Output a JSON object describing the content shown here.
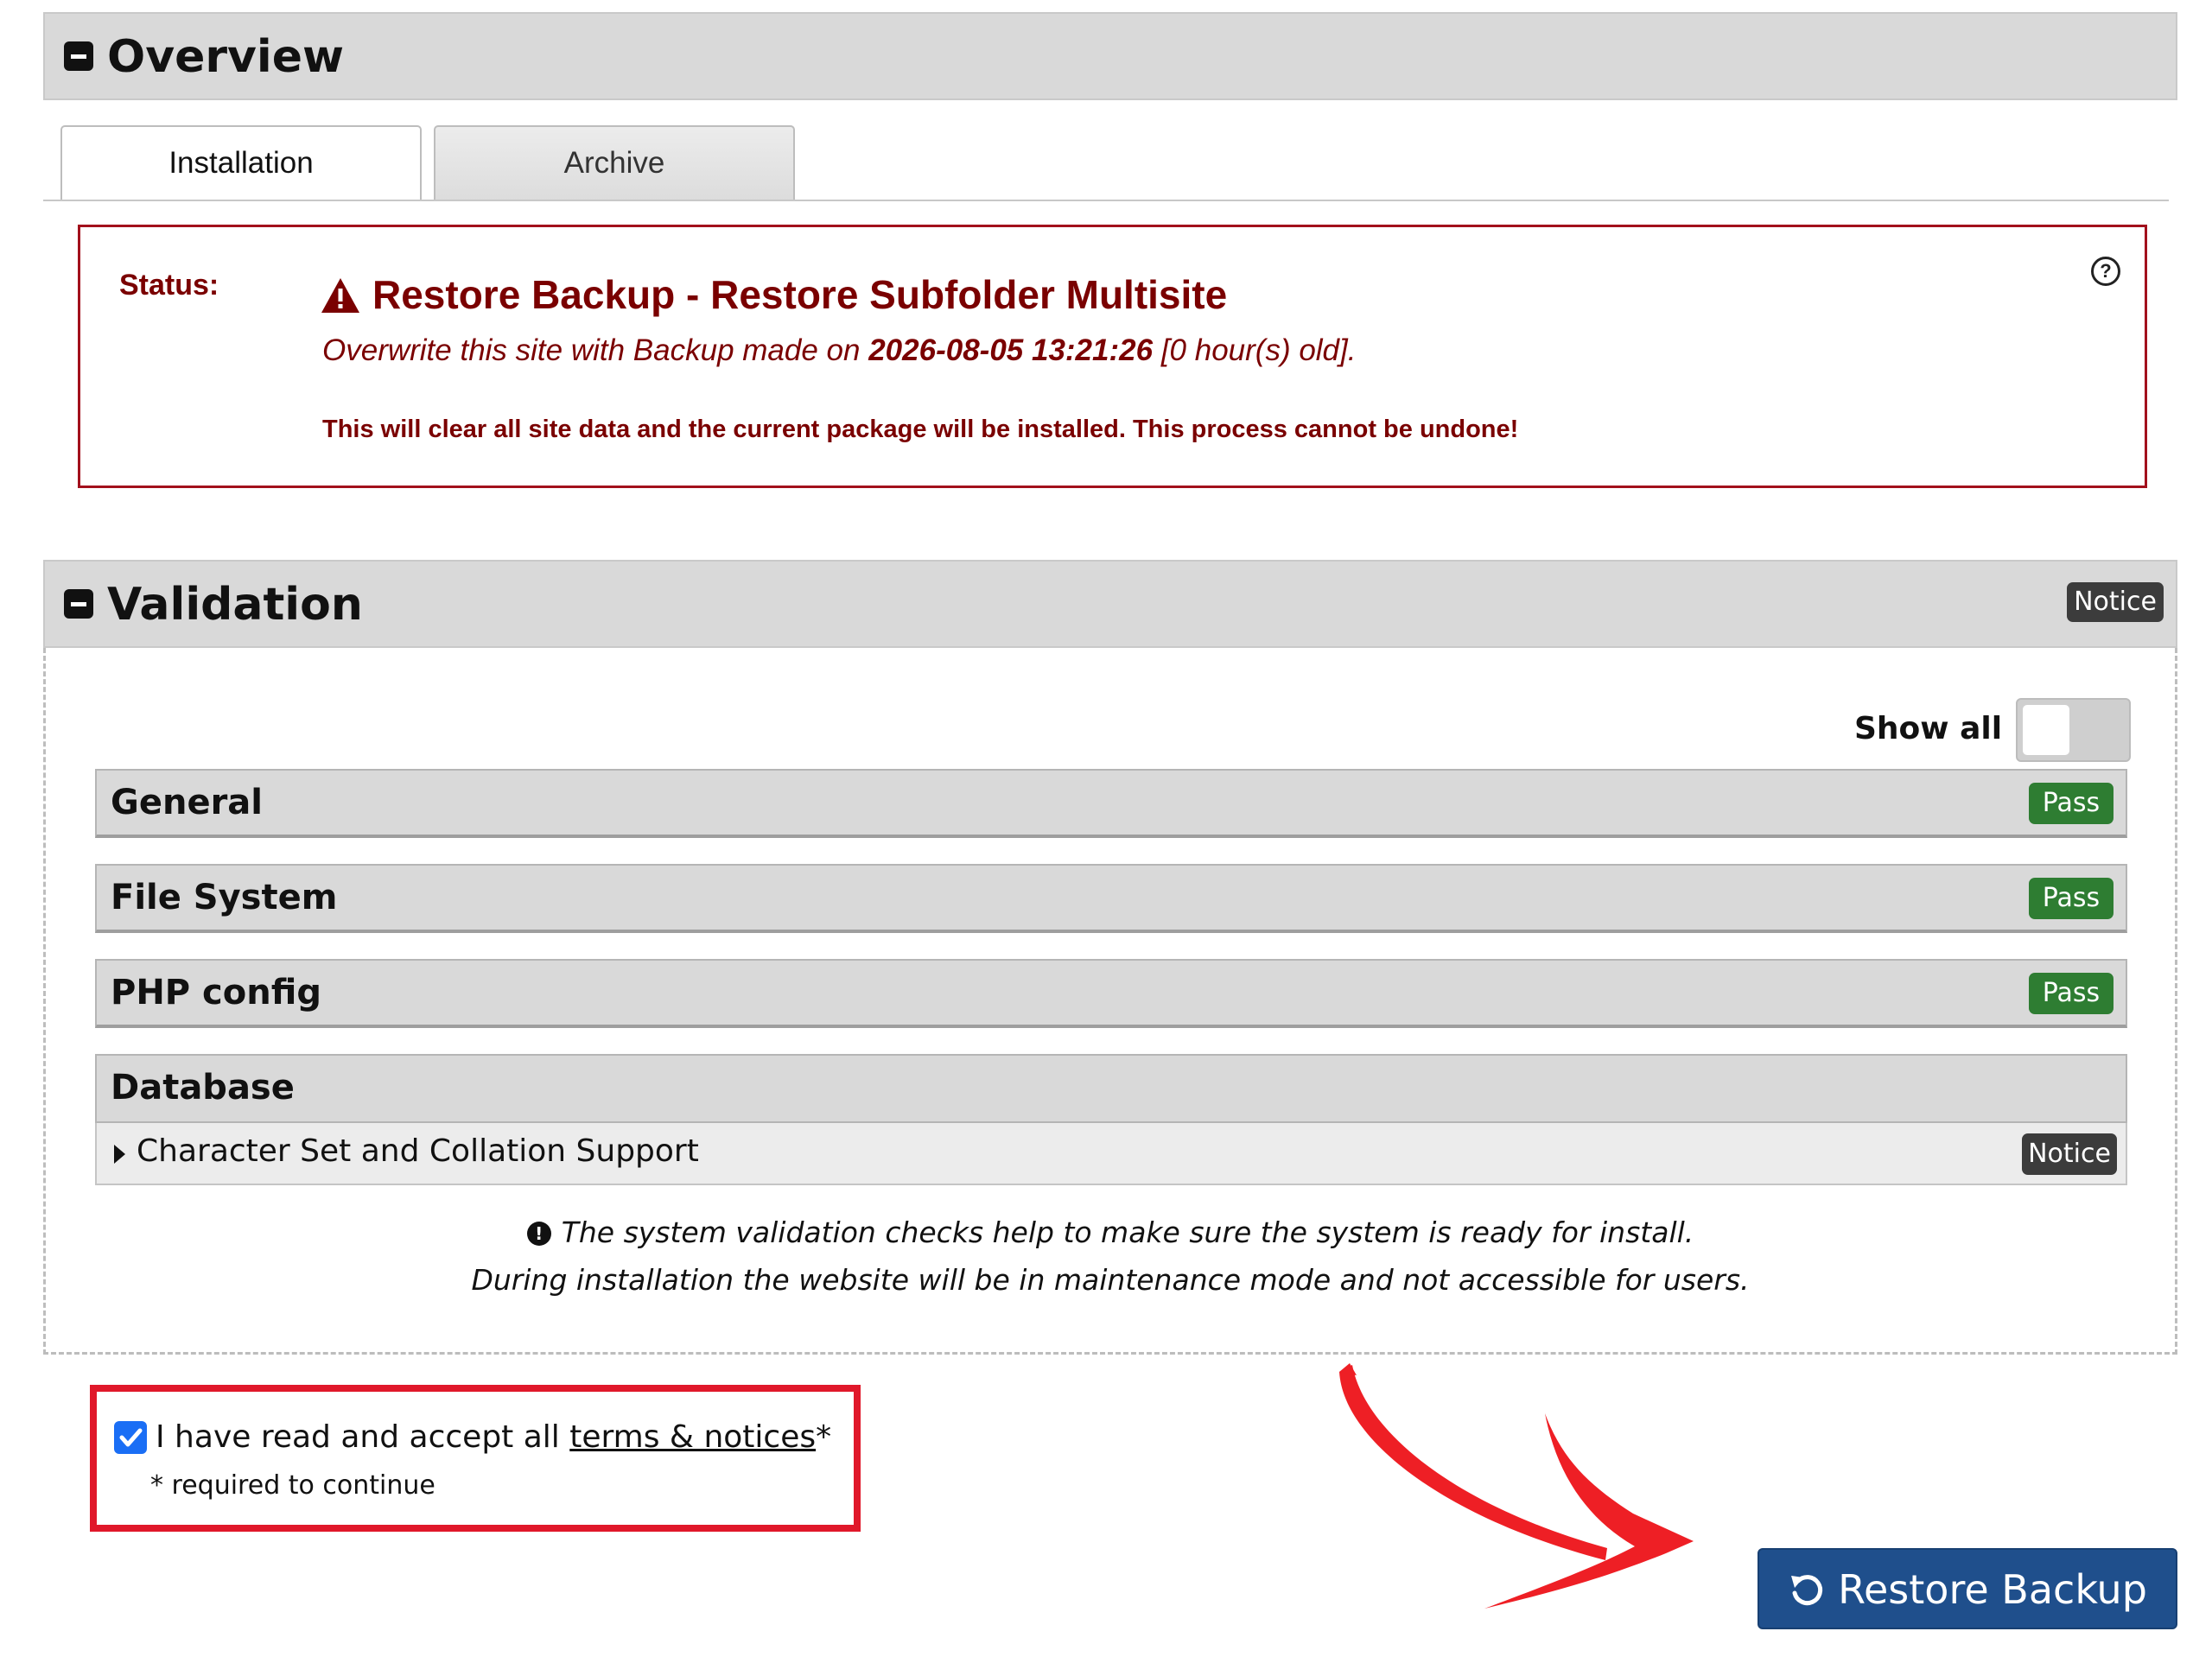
{
  "overview": {
    "title": "Overview",
    "tabs": [
      {
        "label": "Installation",
        "active": true
      },
      {
        "label": "Archive",
        "active": false
      }
    ],
    "status": {
      "label": "Status:",
      "title": "Restore Backup - Restore Subfolder Multisite",
      "subtitle_prefix": "Overwrite this site with Backup made on ",
      "subtitle_date": "2026-08-05 13:21:26",
      "subtitle_suffix": " [0 hour(s) old].",
      "warning": "This will clear all site data and the current package will be installed. This process cannot be undone!",
      "help_icon": "?"
    }
  },
  "validation": {
    "title": "Validation",
    "badge": "Notice",
    "show_all_label": "Show all",
    "show_all_on": false,
    "checks": [
      {
        "title": "General",
        "badge": "Pass"
      },
      {
        "title": "File System",
        "badge": "Pass"
      },
      {
        "title": "PHP config",
        "badge": "Pass"
      },
      {
        "title": "Database",
        "sub_items": [
          {
            "label": "Character Set and Collation Support",
            "badge": "Notice"
          }
        ]
      }
    ],
    "info_line1": "The system validation checks help to make sure the system is ready for install.",
    "info_line2": "During installation the website will be in maintenance mode and not accessible for users."
  },
  "accept": {
    "checked": true,
    "text": "I have read and accept all ",
    "link": "terms & notices",
    "asterisk": "*",
    "note": "* required to continue"
  },
  "restore_button": {
    "label": "Restore Backup",
    "color": "#1f4f8c"
  },
  "colors": {
    "status_red": "#7a0000",
    "frame_red": "#e0182a",
    "pass_green": "#2e7d32",
    "notice_dark": "#3c3c3c"
  }
}
